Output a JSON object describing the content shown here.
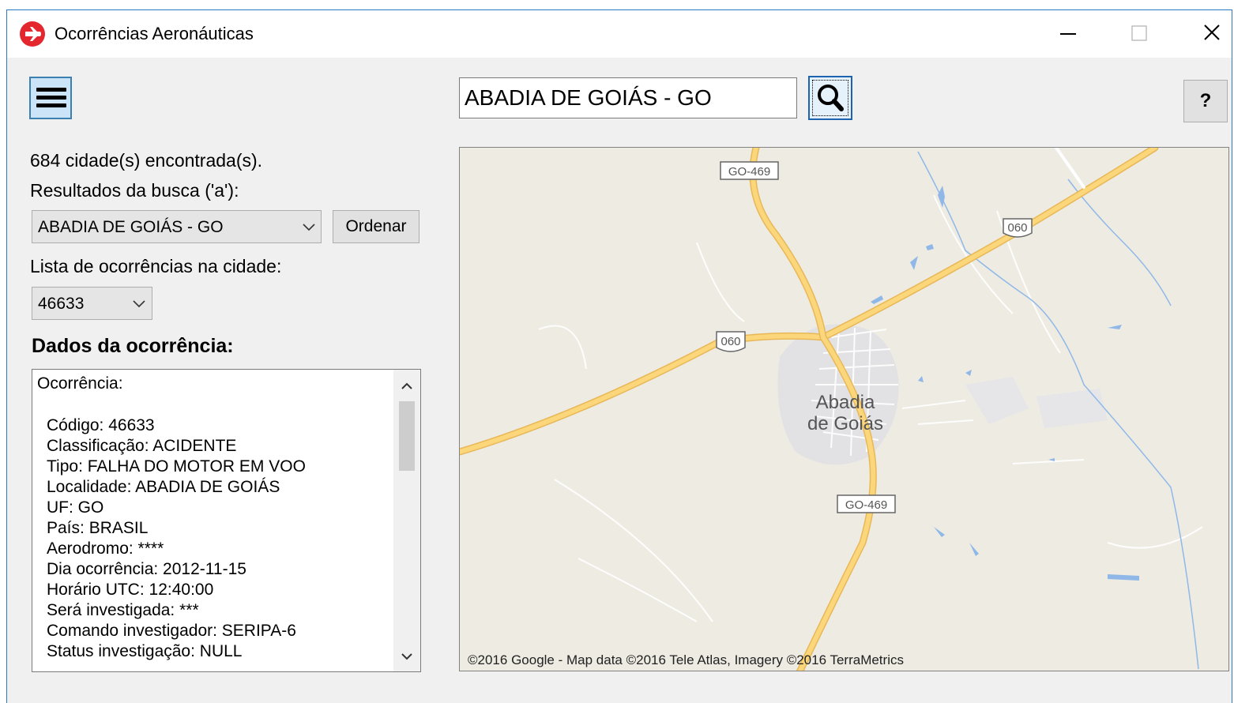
{
  "window": {
    "title": "Ocorrências Aeronáuticas"
  },
  "search": {
    "value": "ABADIA DE GOIÁS - GO"
  },
  "help": {
    "label": "?"
  },
  "results": {
    "count_text": "684 cidade(s) encontrada(s).",
    "search_results_label": "Resultados da busca ('a'):",
    "city_selected": "ABADIA DE GOIÁS - GO",
    "sort_label": "Ordenar",
    "occurrences_label": "Lista de ocorrências na cidade:",
    "occurrence_selected": "46633",
    "details_heading": "Dados da ocorrência:"
  },
  "details": {
    "header": "Ocorrência:",
    "lines": [
      "Código: 46633",
      "Classificação: ACIDENTE",
      "Tipo: FALHA DO MOTOR EM VOO",
      "Localidade: ABADIA DE GOIÁS",
      "UF: GO",
      "País: BRASIL",
      "Aerodromo: ****",
      "Dia ocorrência: 2012-11-15",
      "Horário UTC: 12:40:00",
      "Será investigada: ***",
      "Comando investigador: SERIPA-6",
      "Status investigação: NULL"
    ]
  },
  "map": {
    "city_line1": "Abadia",
    "city_line2": "de Goiás",
    "road_go469_top": "GO-469",
    "road_060_right": "060",
    "road_060_left": "060",
    "road_go469_bottom": "GO-469",
    "attribution": "©2016 Google - Map data ©2016 Tele Atlas, Imagery ©2016 TerraMetrics",
    "colors": {
      "land": "#eeebe3",
      "road": "#fbd67a",
      "road_edge": "#e8b858",
      "water": "#8fb8e8",
      "urban": "#e2e2e4"
    }
  }
}
